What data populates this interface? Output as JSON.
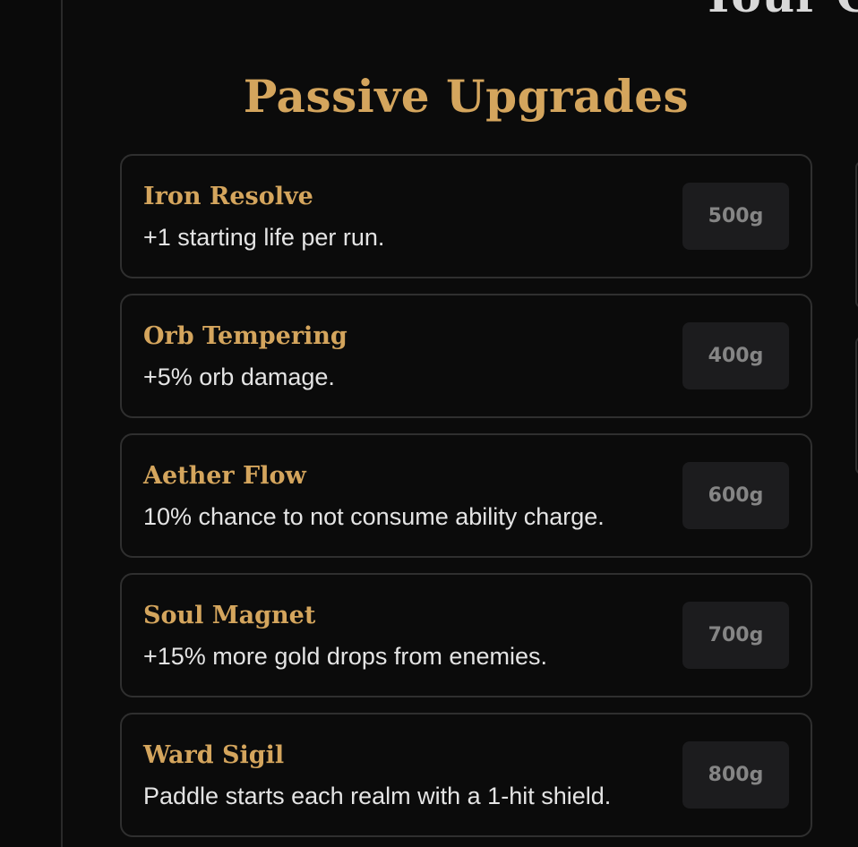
{
  "header": {
    "partial_title": "Your Go"
  },
  "section": {
    "title": "Passive Upgrades"
  },
  "upgrades": [
    {
      "name": "Iron Resolve",
      "description": "+1 starting life per run.",
      "cost": "500g"
    },
    {
      "name": "Orb Tempering",
      "description": "+5% orb damage.",
      "cost": "400g"
    },
    {
      "name": "Aether Flow",
      "description": "10% chance to not consume ability charge.",
      "cost": "600g"
    },
    {
      "name": "Soul Magnet",
      "description": "+15% more gold drops from enemies.",
      "cost": "700g"
    },
    {
      "name": "Ward Sigil",
      "description": "Paddle starts each realm with a 1-hit shield.",
      "cost": "800g"
    }
  ],
  "colors": {
    "background": "#0b0b0b",
    "accent_gold": "#d4a55d",
    "card_border": "#2f2f2f",
    "button_bg": "#1c1c1e",
    "button_text_disabled": "#858585",
    "description_text": "#e4e4e4"
  }
}
